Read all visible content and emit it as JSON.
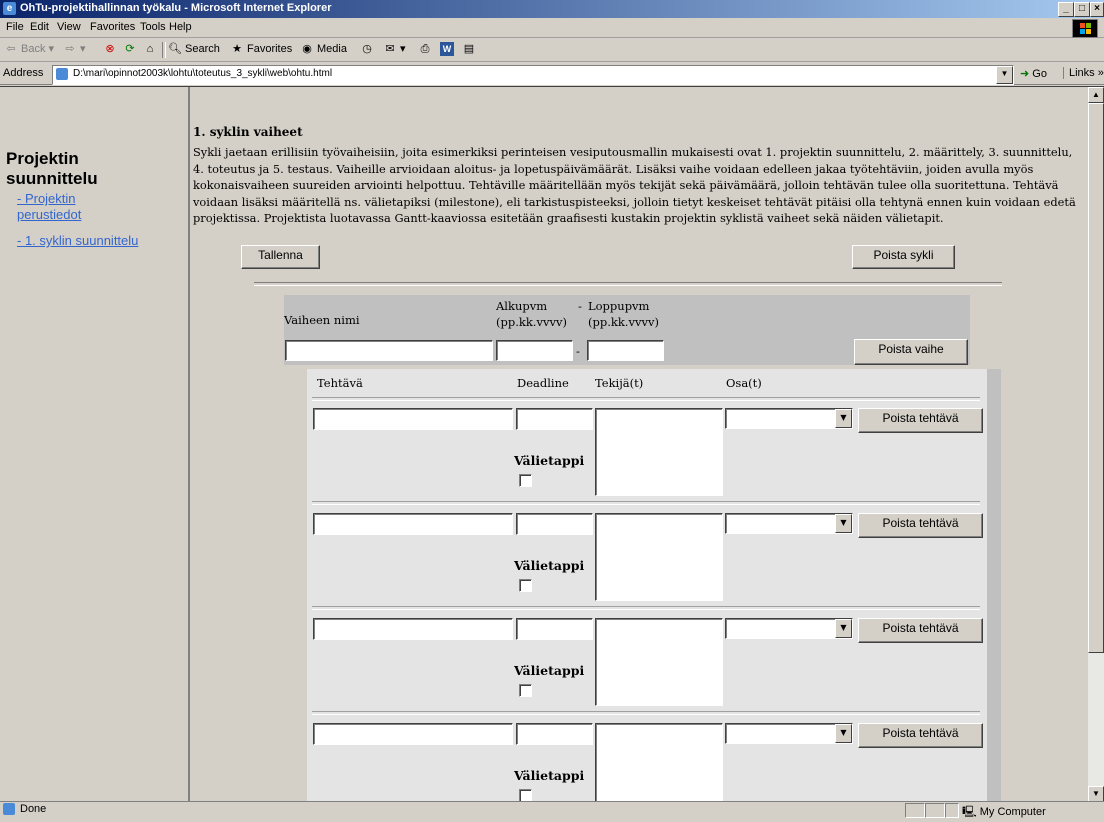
{
  "window": {
    "title": "OhTu-projektihallinnan työkalu - Microsoft Internet Explorer"
  },
  "menu": [
    "File",
    "Edit",
    "View",
    "Favorites",
    "Tools",
    "Help"
  ],
  "toolbar": {
    "back": "Back",
    "search": "Search",
    "favorites": "Favorites",
    "media": "Media"
  },
  "address": {
    "label": "Address",
    "url": "D:\\mari\\opinnot2003k\\lohtu\\toteutus_3_sykli\\web\\ohtu.html",
    "go": "Go",
    "links": "Links"
  },
  "sidebar": {
    "heading_line1": "Projektin",
    "heading_line2": "suunnittelu",
    "links": [
      {
        "line1": "- Projektin",
        "line2": "perustiedot"
      },
      {
        "line1": "- 1. syklin suunnittelu"
      }
    ]
  },
  "main": {
    "title": "1. syklin vaiheet",
    "intro": "Sykli jaetaan erillisiin työvaiheisiin, joita esimerkiksi perinteisen vesiputousmallin mukaisesti ovat 1. projektin suunnittelu, 2. määrittely, 3. suunnittelu, 4. toteutus ja 5. testaus. Vaiheille arvioidaan aloitus- ja lopetuspäivämäärät. Lisäksi vaihe voidaan edelleen jakaa työtehtäviin, joiden avulla myös kokonaisvaiheen suureiden arviointi helpottuu. Tehtäville määritellään myös tekijät sekä päivämäärä, jolloin tehtävän tulee olla suoritettuna. Tehtävä voidaan lisäksi määritellä ns. välietapiksi (milestone), eli tarkistuspisteeksi, jolloin tietyt keskeiset tehtävät pitäisi olla tehtynä ennen kuin voidaan edetä projektissa. Projektista luotavassa Gantt-kaaviossa esitetään graafisesti kustakin projektin syklistä vaiheet sekä näiden välietapit.",
    "save_button": "Tallenna",
    "delete_cycle_button": "Poista sykli"
  },
  "phase": {
    "name_label": "Vaiheen nimi",
    "start_label_1": "Alkupvm",
    "start_label_2": "(pp.kk.vvvv)",
    "dash_top": "-",
    "end_label_1": "Loppupvm",
    "end_label_2": "(pp.kk.vvvv)",
    "date_sep": "-",
    "delete_button": "Poista vaihe",
    "name_value": "",
    "start_value": "",
    "end_value": ""
  },
  "tasks": {
    "columns": [
      "Tehtävä",
      "Deadline",
      "Tekijä(t)",
      "Osa(t)"
    ],
    "milestone_label": "Välietappi",
    "delete_button": "Poista tehtävä",
    "rows": [
      {
        "task": "",
        "deadline": "",
        "assignees": "",
        "part": "",
        "milestone": false
      },
      {
        "task": "",
        "deadline": "",
        "assignees": "",
        "part": "",
        "milestone": false
      },
      {
        "task": "",
        "deadline": "",
        "assignees": "",
        "part": "",
        "milestone": false
      },
      {
        "task": "",
        "deadline": "",
        "assignees": "",
        "part": "",
        "milestone": false
      }
    ]
  },
  "status": {
    "text": "Done",
    "zone": "My Computer"
  }
}
